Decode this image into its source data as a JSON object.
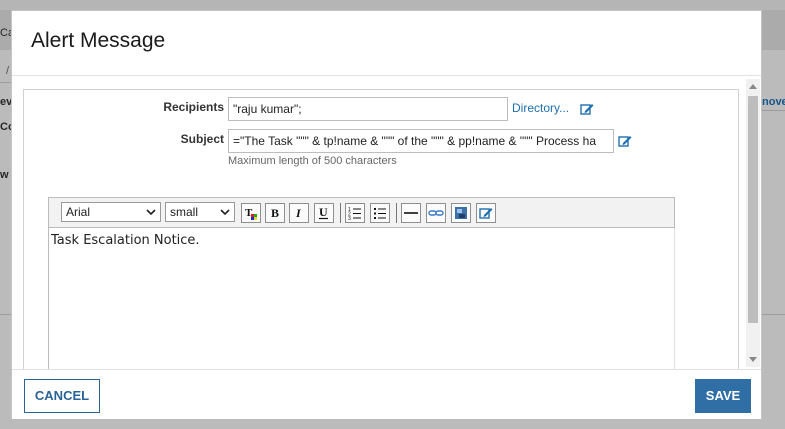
{
  "background": {
    "left_fragments": [
      "Ca",
      "/",
      "ev",
      "Co",
      "w"
    ],
    "right_fragment": "nove"
  },
  "dialog": {
    "title": "Alert Message"
  },
  "form": {
    "recipients_label": "Recipients",
    "recipients_value": "\"raju kumar\";",
    "directory_link": "Directory...",
    "subject_label": "Subject",
    "subject_value": "=\"The Task \"\"\" & tp!name & \"\"\" of the \"\"\" & pp!name & \"\"\" Process ha",
    "subject_helper": "Maximum length of 500 characters"
  },
  "editor": {
    "font_family": "Arial",
    "font_size": "small",
    "toolbar_buttons": [
      "text-color",
      "bold",
      "italic",
      "underline",
      "ordered-list",
      "unordered-list",
      "horizontal-rule",
      "link",
      "image",
      "source-edit"
    ],
    "content": "Task Escalation Notice."
  },
  "footer": {
    "cancel_label": "CANCEL",
    "save_label": "SAVE"
  },
  "colors": {
    "accent": "#2f6fa6",
    "link": "#1e6fb0"
  }
}
